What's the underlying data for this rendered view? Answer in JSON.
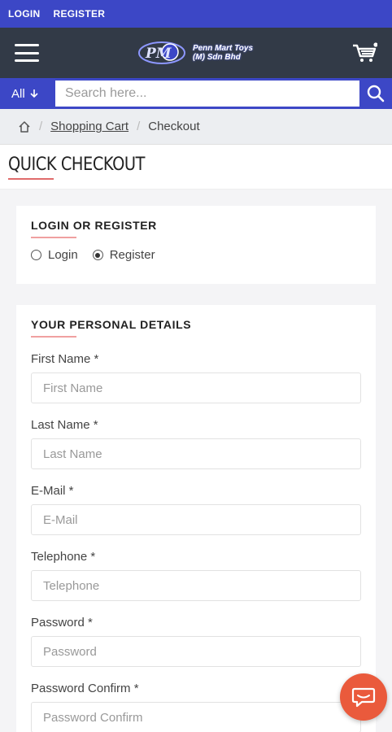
{
  "topbar": {
    "login": "LOGIN",
    "register": "REGISTER"
  },
  "header": {
    "logo_line1": "Penn Mart Toys",
    "logo_line2": "(M) Sdn Bhd",
    "menu_icon": "hamburger-icon",
    "cart_icon": "cart-icon"
  },
  "search": {
    "category": "All",
    "placeholder": "Search here...",
    "button_icon": "search-icon"
  },
  "breadcrumb": {
    "home_icon": "home-icon",
    "items": [
      "Shopping Cart",
      "Checkout"
    ]
  },
  "page": {
    "title": "QUICK CHECKOUT"
  },
  "login_section": {
    "title": "LOGIN OR REGISTER",
    "options": [
      "Login",
      "Register"
    ],
    "selected": "Register"
  },
  "personal": {
    "title": "YOUR PERSONAL DETAILS",
    "fields": [
      {
        "label": "First Name *",
        "placeholder": "First Name"
      },
      {
        "label": "Last Name *",
        "placeholder": "Last Name"
      },
      {
        "label": "E-Mail *",
        "placeholder": "E-Mail"
      },
      {
        "label": "Telephone *",
        "placeholder": "Telephone"
      },
      {
        "label": "Password *",
        "placeholder": "Password"
      },
      {
        "label": "Password Confirm *",
        "placeholder": "Password Confirm"
      }
    ]
  },
  "chat": {
    "icon": "chat-bubble-icon"
  },
  "colors": {
    "brand": "#3c47c6",
    "header": "#323a47",
    "accent": "#e06b6b",
    "chat": "#ea5a3c"
  }
}
